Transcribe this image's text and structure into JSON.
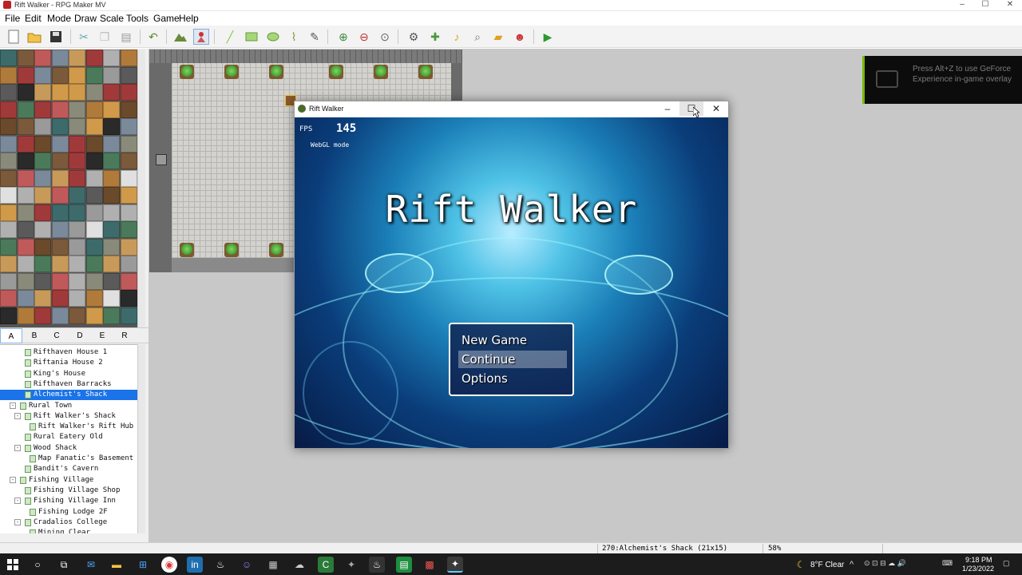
{
  "titlebar": {
    "title": "Rift Walker - RPG Maker MV",
    "minimize": "–",
    "maximize": "☐",
    "close": "✕"
  },
  "menu": [
    "File",
    "Edit",
    "Mode",
    "Draw",
    "Scale",
    "Tools",
    "Game",
    "Help"
  ],
  "toolbar": {
    "icons": [
      "new-icon",
      "open-icon",
      "save-icon",
      "cut-icon",
      "copy-icon",
      "paste-icon",
      "undo-icon",
      "map-mode-icon",
      "event-mode-icon",
      "pencil-icon",
      "rectangle-icon",
      "ellipse-icon",
      "fill-icon",
      "shadow-pen-icon",
      "zoom-in-icon",
      "zoom-out-icon",
      "actual-size-icon",
      "database-icon",
      "plugin-manager-icon",
      "sound-test-icon",
      "event-search-icon",
      "resource-manager-icon",
      "character-generator-icon",
      "playtest-icon"
    ]
  },
  "tileset_tabs": [
    "A",
    "B",
    "C",
    "D",
    "E",
    "R"
  ],
  "active_tab": "A",
  "maplist": [
    {
      "label": "Rifthaven House 1",
      "indent": 2
    },
    {
      "label": "Riftania House 2",
      "indent": 2
    },
    {
      "label": "King's House",
      "indent": 2
    },
    {
      "label": "Rifthaven Barracks",
      "indent": 2
    },
    {
      "label": "Alchemist's Shack",
      "indent": 2,
      "selected": true
    },
    {
      "label": "Rural Town",
      "indent": 1,
      "toggle": "⊟"
    },
    {
      "label": "Rift Walker's Shack",
      "indent": 2,
      "toggle": "⊟"
    },
    {
      "label": "Rift Walker's Rift Hub",
      "indent": 3
    },
    {
      "label": "Rural Eatery Old",
      "indent": 2
    },
    {
      "label": "Wood Shack",
      "indent": 2,
      "toggle": "⊟"
    },
    {
      "label": "Map Fanatic's Basement",
      "indent": 3
    },
    {
      "label": "Bandit's Cavern",
      "indent": 2
    },
    {
      "label": "Fishing Village",
      "indent": 1,
      "toggle": "⊟"
    },
    {
      "label": "Fishing Village Shop",
      "indent": 2
    },
    {
      "label": "Fishing Village Inn",
      "indent": 2,
      "toggle": "⊟"
    },
    {
      "label": "Fishing Lodge 2F",
      "indent": 3
    },
    {
      "label": "Cradalios College",
      "indent": 2,
      "toggle": "⊟"
    },
    {
      "label": "Mining Clear",
      "indent": 3
    }
  ],
  "statusbar": {
    "map_info": "270:Alchemist's Shack (21x15)",
    "zoom": "58%"
  },
  "nvidia_overlay": {
    "text": "Press Alt+Z to use GeForce Experience in-game overlay"
  },
  "game_window": {
    "title": "Rift Walker",
    "fps_label": "FPS",
    "fps_value": "145",
    "render_mode": "WebGL mode",
    "game_title": "Rift Walker",
    "commands": [
      {
        "label": "New Game",
        "selected": false
      },
      {
        "label": "Continue",
        "selected": true
      },
      {
        "label": "Options",
        "selected": false
      }
    ]
  },
  "taskbar": {
    "weather": "8°F  Clear",
    "time": "9:18 PM",
    "date": "1/23/2022"
  }
}
